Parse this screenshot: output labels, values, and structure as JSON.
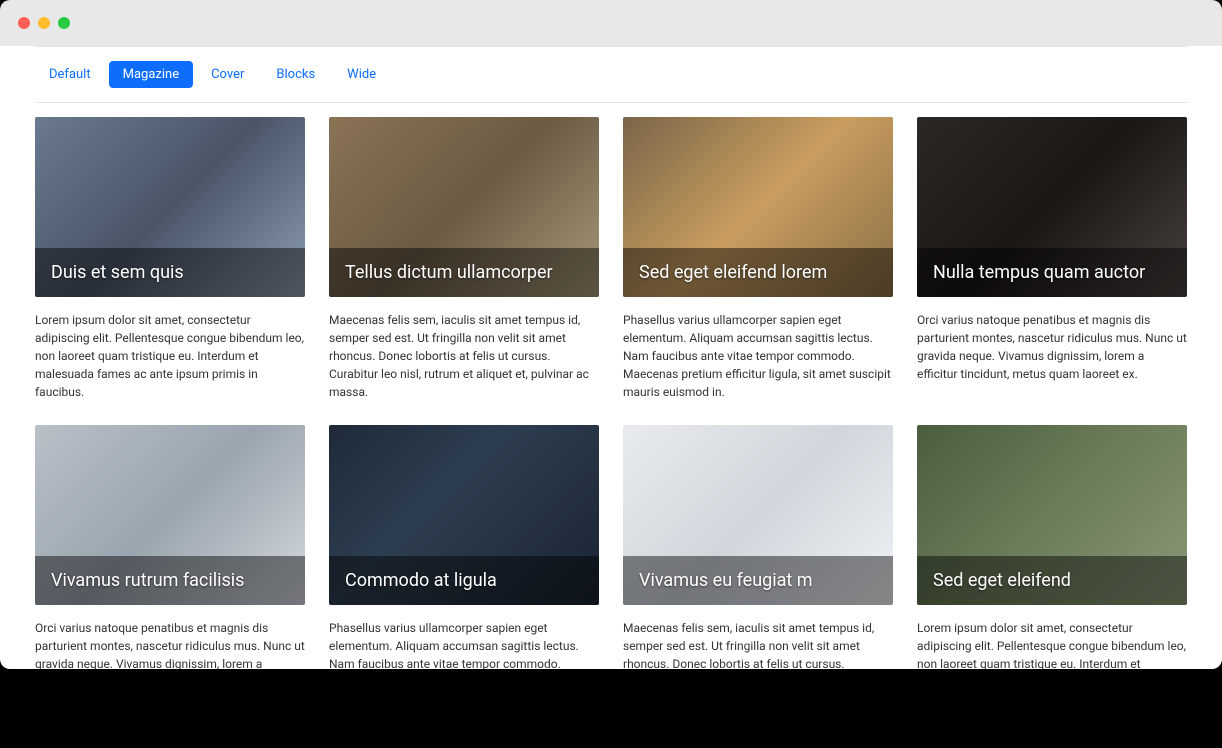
{
  "tabs": [
    {
      "label": "Default",
      "active": false
    },
    {
      "label": "Magazine",
      "active": true
    },
    {
      "label": "Cover",
      "active": false
    },
    {
      "label": "Blocks",
      "active": false
    },
    {
      "label": "Wide",
      "active": false
    }
  ],
  "cards": [
    {
      "title": "Duis et sem quis",
      "excerpt": "Lorem ipsum dolor sit amet, consectetur adipiscing elit. Pellentesque congue bibendum leo, non laoreet quam tristique eu. Interdum et malesuada fames ac ante ipsum primis in faucibus."
    },
    {
      "title": "Tellus dictum ullamcorper",
      "excerpt": "Maecenas felis sem, iaculis sit amet tempus id, semper sed est. Ut fringilla non velit sit amet rhoncus. Donec lobortis at felis ut cursus. Curabitur leo nisl, rutrum et aliquet et, pulvinar ac massa."
    },
    {
      "title": "Sed eget eleifend lorem",
      "excerpt": "Phasellus varius ullamcorper sapien eget elementum. Aliquam accumsan sagittis lectus. Nam faucibus ante vitae tempor commodo. Maecenas pretium efficitur ligula, sit amet suscipit mauris euismod in."
    },
    {
      "title": "Nulla tempus quam auctor",
      "excerpt": "Orci varius natoque penatibus et magnis dis parturient montes, nascetur ridiculus mus. Nunc ut gravida neque. Vivamus dignissim, lorem a efficitur tincidunt, metus quam laoreet ex."
    },
    {
      "title": "Vivamus rutrum facilisis",
      "excerpt": "Orci varius natoque penatibus et magnis dis parturient montes, nascetur ridiculus mus. Nunc ut gravida neque. Vivamus dignissim, lorem a efficitur tincidunt, metus quam laoreet ex."
    },
    {
      "title": "Commodo at ligula",
      "excerpt": "Phasellus varius ullamcorper sapien eget elementum. Aliquam accumsan sagittis lectus. Nam faucibus ante vitae tempor commodo. Maecenas pretium efficitur ligula, sit amet suscipit mauris euismod in."
    },
    {
      "title": "Vivamus eu feugiat m",
      "excerpt": "Maecenas felis sem, iaculis sit amet tempus id, semper sed est. Ut fringilla non velit sit amet rhoncus. Donec lobortis at felis ut cursus. Curabitur leo nisl, rutrum et aliquet et, pulvinar ac massa."
    },
    {
      "title": "Sed eget eleifend",
      "excerpt": "Lorem ipsum dolor sit amet, consectetur adipiscing elit. Pellentesque congue bibendum leo, non laoreet quam tristique eu. Interdum et malesuada fames ac ante ipsum primis in faucibus."
    }
  ]
}
